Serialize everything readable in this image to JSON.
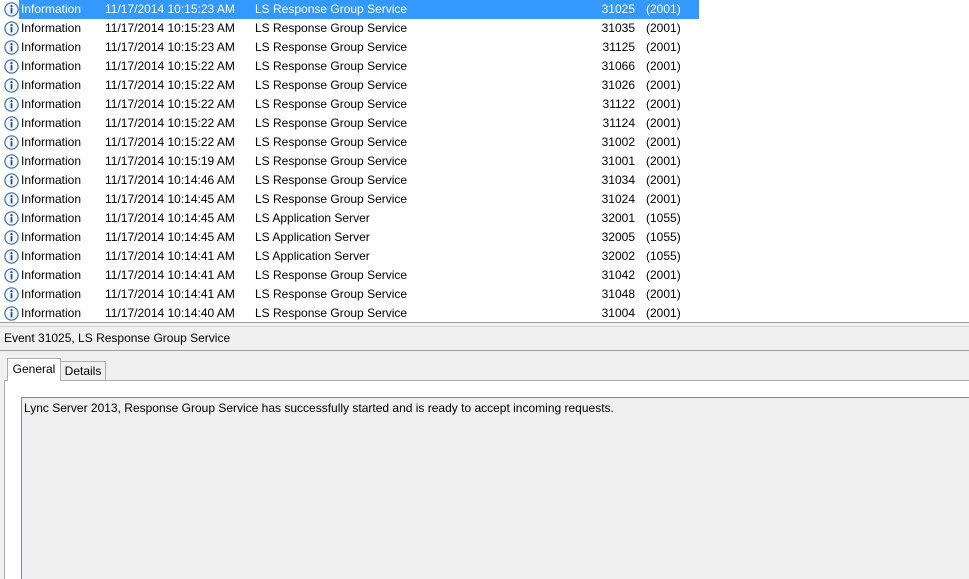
{
  "colors": {
    "selection_background": "#3399ff",
    "selection_text": "#ffffff",
    "info_icon_ring": "#4a77b4",
    "info_icon_glyph": "#1f4f91"
  },
  "event_list": {
    "rows": [
      {
        "icon": "information-icon",
        "level": "Information",
        "date_time": "11/17/2014 10:15:23 AM",
        "source": "LS Response Group Service",
        "event_id": "31025",
        "task_category": "(2001)",
        "selected": true
      },
      {
        "icon": "information-icon",
        "level": "Information",
        "date_time": "11/17/2014 10:15:23 AM",
        "source": "LS Response Group Service",
        "event_id": "31035",
        "task_category": "(2001)",
        "selected": false
      },
      {
        "icon": "information-icon",
        "level": "Information",
        "date_time": "11/17/2014 10:15:23 AM",
        "source": "LS Response Group Service",
        "event_id": "31125",
        "task_category": "(2001)",
        "selected": false
      },
      {
        "icon": "information-icon",
        "level": "Information",
        "date_time": "11/17/2014 10:15:22 AM",
        "source": "LS Response Group Service",
        "event_id": "31066",
        "task_category": "(2001)",
        "selected": false
      },
      {
        "icon": "information-icon",
        "level": "Information",
        "date_time": "11/17/2014 10:15:22 AM",
        "source": "LS Response Group Service",
        "event_id": "31026",
        "task_category": "(2001)",
        "selected": false
      },
      {
        "icon": "information-icon",
        "level": "Information",
        "date_time": "11/17/2014 10:15:22 AM",
        "source": "LS Response Group Service",
        "event_id": "31122",
        "task_category": "(2001)",
        "selected": false
      },
      {
        "icon": "information-icon",
        "level": "Information",
        "date_time": "11/17/2014 10:15:22 AM",
        "source": "LS Response Group Service",
        "event_id": "31124",
        "task_category": "(2001)",
        "selected": false
      },
      {
        "icon": "information-icon",
        "level": "Information",
        "date_time": "11/17/2014 10:15:22 AM",
        "source": "LS Response Group Service",
        "event_id": "31002",
        "task_category": "(2001)",
        "selected": false
      },
      {
        "icon": "information-icon",
        "level": "Information",
        "date_time": "11/17/2014 10:15:19 AM",
        "source": "LS Response Group Service",
        "event_id": "31001",
        "task_category": "(2001)",
        "selected": false
      },
      {
        "icon": "information-icon",
        "level": "Information",
        "date_time": "11/17/2014 10:14:46 AM",
        "source": "LS Response Group Service",
        "event_id": "31034",
        "task_category": "(2001)",
        "selected": false
      },
      {
        "icon": "information-icon",
        "level": "Information",
        "date_time": "11/17/2014 10:14:45 AM",
        "source": "LS Response Group Service",
        "event_id": "31024",
        "task_category": "(2001)",
        "selected": false
      },
      {
        "icon": "information-icon",
        "level": "Information",
        "date_time": "11/17/2014 10:14:45 AM",
        "source": "LS Application Server",
        "event_id": "32001",
        "task_category": "(1055)",
        "selected": false
      },
      {
        "icon": "information-icon",
        "level": "Information",
        "date_time": "11/17/2014 10:14:45 AM",
        "source": "LS Application Server",
        "event_id": "32005",
        "task_category": "(1055)",
        "selected": false
      },
      {
        "icon": "information-icon",
        "level": "Information",
        "date_time": "11/17/2014 10:14:41 AM",
        "source": "LS Application Server",
        "event_id": "32002",
        "task_category": "(1055)",
        "selected": false
      },
      {
        "icon": "information-icon",
        "level": "Information",
        "date_time": "11/17/2014 10:14:41 AM",
        "source": "LS Response Group Service",
        "event_id": "31042",
        "task_category": "(2001)",
        "selected": false
      },
      {
        "icon": "information-icon",
        "level": "Information",
        "date_time": "11/17/2014 10:14:41 AM",
        "source": "LS Response Group Service",
        "event_id": "31048",
        "task_category": "(2001)",
        "selected": false
      },
      {
        "icon": "information-icon",
        "level": "Information",
        "date_time": "11/17/2014 10:14:40 AM",
        "source": "LS Response Group Service",
        "event_id": "31004",
        "task_category": "(2001)",
        "selected": false
      }
    ]
  },
  "detail": {
    "header": "Event 31025, LS Response Group Service",
    "tabs": [
      {
        "label": "General",
        "selected": true
      },
      {
        "label": "Details",
        "selected": false
      }
    ],
    "general_text": "Lync Server 2013, Response Group Service has successfully started and is ready to accept incoming requests."
  }
}
